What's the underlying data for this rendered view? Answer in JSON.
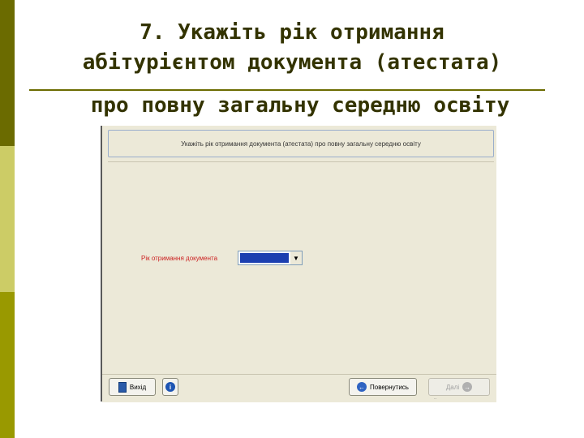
{
  "slide": {
    "title_line1": "7. Укажіть рік отримання",
    "title_line2": "абітурієнтом документа (атестата)",
    "title_line3": "про повну загальну середню освіту"
  },
  "window": {
    "header_text": "Укажіть рік отримання документа (атестата) про повну загальну середню освіту",
    "field_label": "Рік отримання документа",
    "select_value": "",
    "select_arrow": "▼"
  },
  "buttons": {
    "exit_label": "Вихід",
    "help_icon": "i",
    "back_label": "Повернутись",
    "back_icon": "←",
    "next_label": "Далі",
    "next_icon": "→"
  },
  "page_mark": "..",
  "colors": {
    "accent_dark": "#6b6b00",
    "accent_light": "#cccc66",
    "accent_mid": "#999900",
    "label_red": "#cc2222",
    "select_blue": "#1c3fb0"
  }
}
